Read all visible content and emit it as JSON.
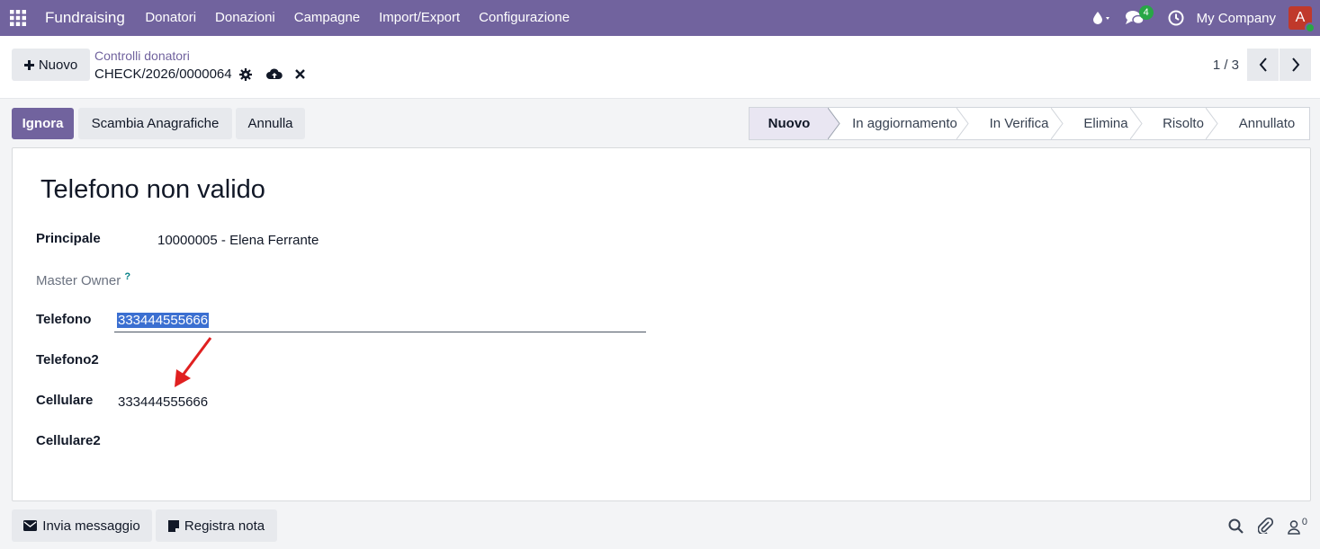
{
  "topnav": {
    "brand": "Fundraising",
    "menu": [
      "Donatori",
      "Donazioni",
      "Campagne",
      "Import/Export",
      "Configurazione"
    ],
    "messages_count": "4",
    "company": "My Company",
    "avatar_letter": "A",
    "icons": [
      "apps-grid-icon",
      "water-drop-icon",
      "chat-icon",
      "clock-icon"
    ]
  },
  "control": {
    "new_label": "Nuovo",
    "breadcrumb": "Controlli donatori",
    "record_name": "CHECK/2026/0000064",
    "pager": "1 / 3"
  },
  "actions": {
    "ignore": "Ignora",
    "swap": "Scambia Anagrafiche",
    "cancel": "Annulla"
  },
  "statusbar": {
    "stages": [
      "Nuovo",
      "In aggiornamento",
      "In Verifica",
      "Elimina",
      "Risolto",
      "Annullato"
    ],
    "active": "Nuovo"
  },
  "form": {
    "title": "Telefono non valido",
    "principale_label": "Principale",
    "principale_value": "10000005 - Elena Ferrante",
    "master_owner_label": "Master Owner",
    "master_owner_help": "?",
    "telefono_label": "Telefono",
    "telefono_value": "333444555666",
    "telefono2_label": "Telefono2",
    "cellulare_label": "Cellulare",
    "cellulare_value": "333444555666",
    "cellulare2_label": "Cellulare2"
  },
  "chatter": {
    "send_message": "Invia messaggio",
    "log_note": "Registra nota",
    "followers_count": "0"
  },
  "colors": {
    "brand": "#71639e",
    "annotation_arrow": "#e02020"
  }
}
